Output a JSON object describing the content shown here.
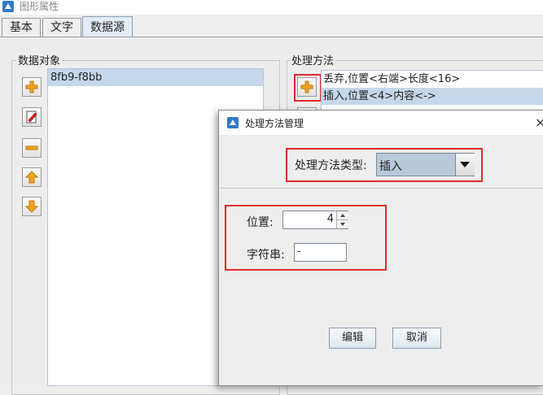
{
  "window": {
    "title": "图形属性"
  },
  "tabs": [
    "基本",
    "文字",
    "数据源"
  ],
  "data_objects": {
    "label": "数据对象",
    "items": [
      "8fb9-f8bb"
    ]
  },
  "methods": {
    "label": "处理方法",
    "items": [
      "丢弃,位置<右端>长度<16>",
      "插入,位置<4>内容<->"
    ]
  },
  "dialog": {
    "title": "处理方法管理",
    "close": "×",
    "type_label": "处理方法类型:",
    "type_value": "插入",
    "position_label": "位置:",
    "position_value": "4",
    "string_label": "字符串:",
    "string_value": "-",
    "edit_button": "编辑",
    "cancel_button": "取消"
  },
  "colors": {
    "highlight": "#e02a2a",
    "selection": "#c5d7ea",
    "icon_orange": "#f2a31b"
  }
}
